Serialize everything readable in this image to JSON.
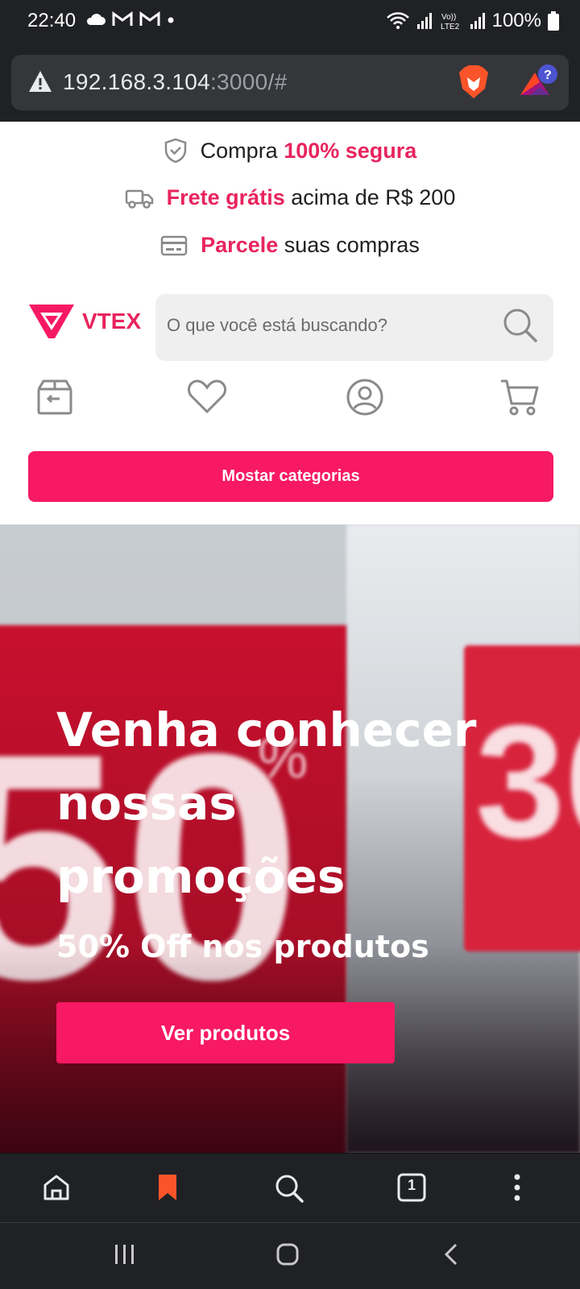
{
  "status_bar": {
    "time": "22:40",
    "battery": "100%",
    "icons": [
      "cloud-icon",
      "gmail-icon",
      "gmail-icon",
      "dot-icon",
      "wifi-icon",
      "signal-icon",
      "volte-icon",
      "signal-icon",
      "battery-icon"
    ]
  },
  "browser": {
    "url_host": "192.168.3.104",
    "url_rest": ":3000/#",
    "icons": [
      "warning-icon",
      "brave-lion-icon",
      "brave-rewards-icon"
    ]
  },
  "benefits": {
    "b1_pre": "Compra ",
    "b1_hl": "100% segura",
    "b2_hl": "Frete grátis",
    "b2_post": " acima de R$ 200",
    "b3_hl": "Parcele",
    "b3_post": " suas compras"
  },
  "header": {
    "logo_text": "VTEX",
    "search_placeholder": "O que você está buscando?"
  },
  "categories_button": "Mostar categorias",
  "hero": {
    "title": "Venha conhecer nossas promoções",
    "subtitle": "50% Off nos produtos",
    "button": "Ver produtos",
    "bg_text_left": "50",
    "bg_text_right": "30",
    "bg_text_pct": "%"
  },
  "bottom_toolbar": {
    "tab_count": "1"
  },
  "colors": {
    "brand": "#f71963",
    "highlight": "#e8245e"
  }
}
